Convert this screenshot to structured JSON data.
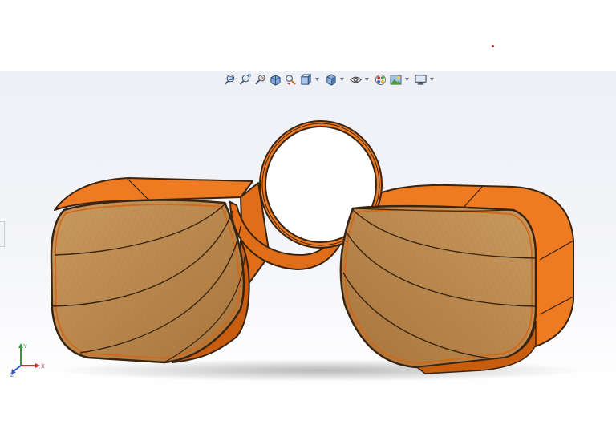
{
  "viewport": {
    "background_top": "#eef0f6",
    "background_bottom": "#ffffff"
  },
  "toolbar": {
    "buttons": [
      {
        "icon": "zoom-to-fit-icon",
        "has_dropdown": false
      },
      {
        "icon": "zoom-to-area-icon",
        "has_dropdown": false
      },
      {
        "icon": "previous-view-icon",
        "has_dropdown": false
      },
      {
        "icon": "section-view-icon",
        "has_dropdown": false
      },
      {
        "icon": "dynamic-annotation-icon",
        "has_dropdown": false
      },
      {
        "icon": "view-orientation-icon",
        "has_dropdown": true
      },
      {
        "icon": "display-style-icon",
        "has_dropdown": true
      },
      {
        "icon": "hide-show-items-icon",
        "has_dropdown": true
      },
      {
        "icon": "edit-appearance-icon",
        "has_dropdown": false
      },
      {
        "icon": "apply-scene-icon",
        "has_dropdown": true
      },
      {
        "icon": "view-settings-icon",
        "has_dropdown": true
      }
    ]
  },
  "model": {
    "body_color": "#ee7a22",
    "body_shade": "#c85d10",
    "edge_color": "#3a2410",
    "wood_color": "#c08a4e",
    "hole_color": "#ffffff"
  },
  "triad": {
    "x_label": "X",
    "y_label": "Y",
    "z_label": "Z",
    "x_color": "#d03030",
    "y_color": "#2f9a3a",
    "z_color": "#2f55c8"
  }
}
